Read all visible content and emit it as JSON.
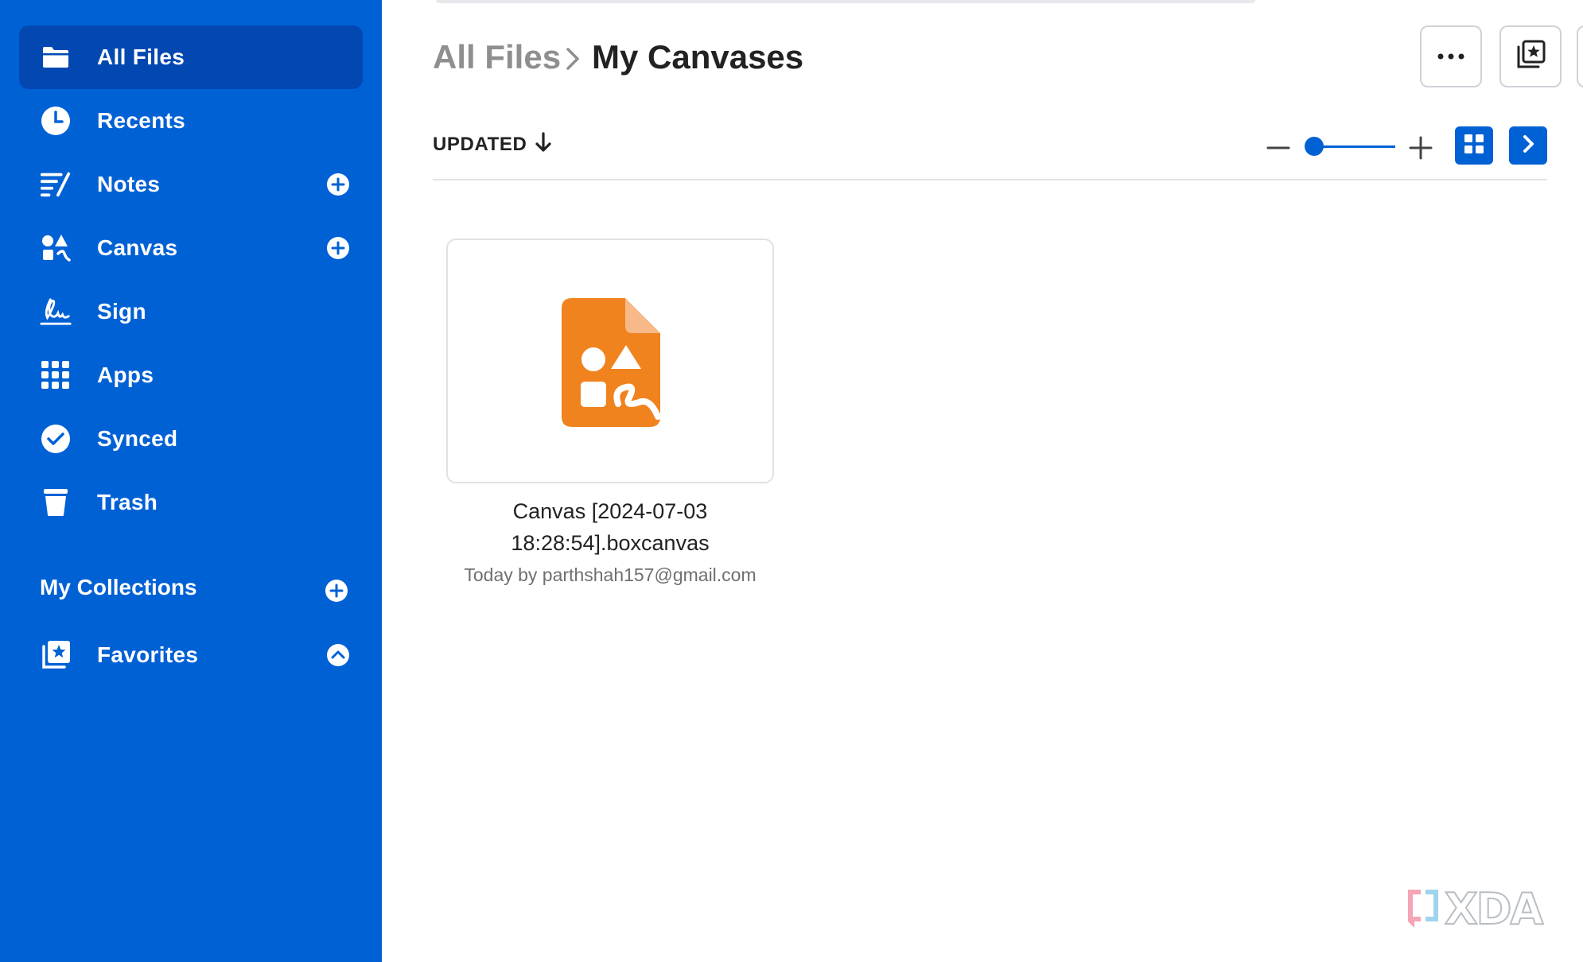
{
  "sidebar": {
    "items": [
      {
        "label": "All Files",
        "icon": "folder-icon",
        "active": true
      },
      {
        "label": "Recents",
        "icon": "clock-icon"
      },
      {
        "label": "Notes",
        "icon": "notes-icon",
        "has_add": true
      },
      {
        "label": "Canvas",
        "icon": "canvas-icon",
        "has_add": true
      },
      {
        "label": "Sign",
        "icon": "signature-icon"
      },
      {
        "label": "Apps",
        "icon": "apps-grid-icon"
      },
      {
        "label": "Synced",
        "icon": "check-circle-icon"
      },
      {
        "label": "Trash",
        "icon": "trash-icon"
      }
    ],
    "collections_heading": "My Collections",
    "favorites": {
      "label": "Favorites",
      "icon": "favorites-icon",
      "expanded": true
    }
  },
  "breadcrumb": {
    "root": "All Files",
    "current": "My Canvases"
  },
  "toolbar": {
    "sort_label": "UPDATED",
    "sort_direction": "descending",
    "zoom_level": 0,
    "view_mode": "grid"
  },
  "files": [
    {
      "name_line1": "Canvas [2024-07-03",
      "name_line2": "18:28:54].boxcanvas",
      "meta": "Today by parthshah157@gmail.com",
      "icon": "canvas-file-icon"
    }
  ],
  "watermark": "XDA",
  "colors": {
    "sidebar_bg": "#0061D5",
    "sidebar_active": "#0248B0",
    "canvas_orange": "#F0831E",
    "accent": "#0061D5"
  }
}
